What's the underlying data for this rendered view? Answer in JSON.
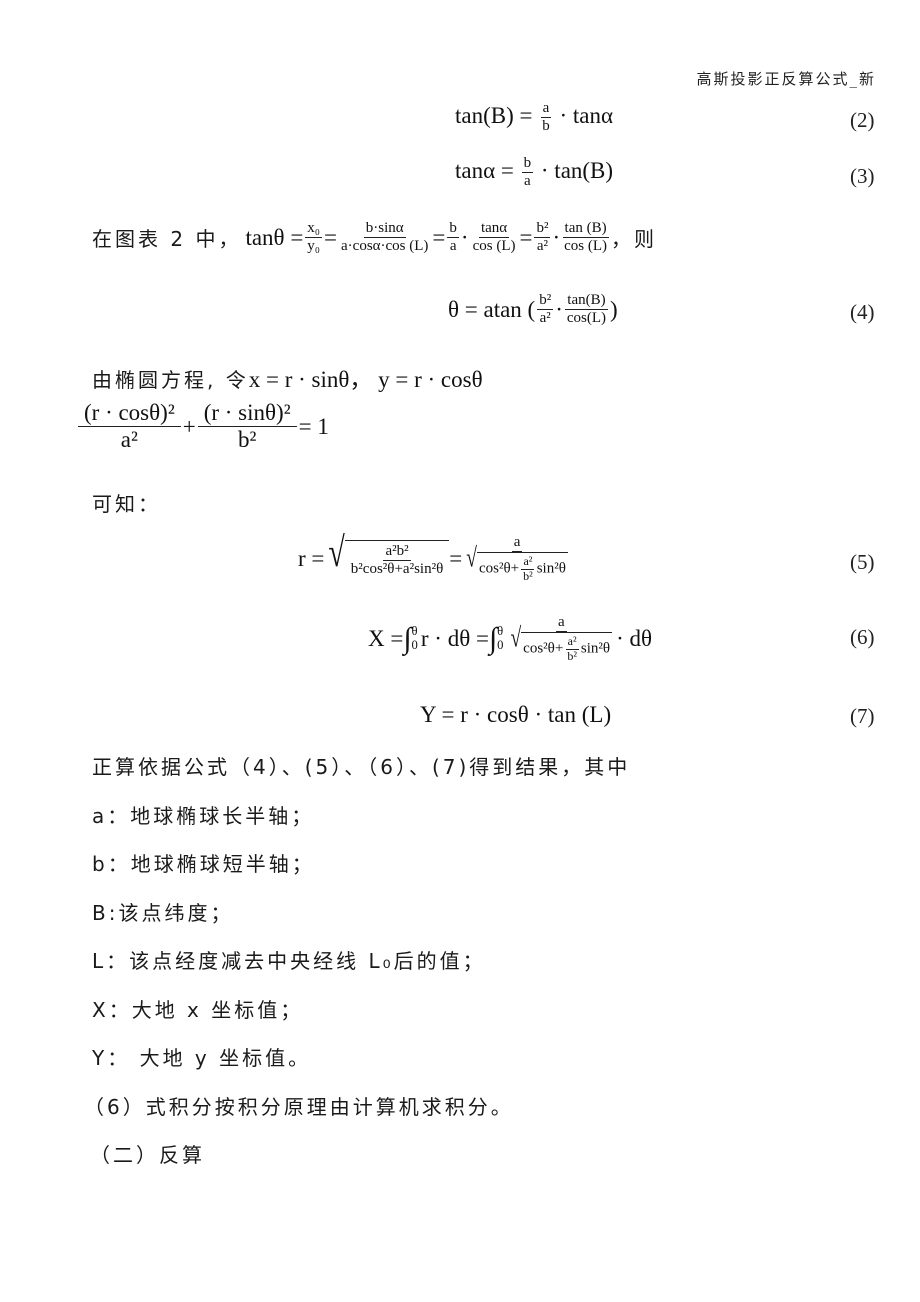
{
  "header": {
    "title": "高斯投影正反算公式_新"
  },
  "equations": {
    "eq2": {
      "lhs": "tan(B)",
      "eq": "=",
      "num": "a",
      "den": "b",
      "rhs": "· tanα",
      "number": "(2)"
    },
    "eq3": {
      "lhs": "tanα",
      "eq": "=",
      "num": "b",
      "den": "a",
      "rhs": "· tan(B)",
      "number": "(3)"
    },
    "intro_line": {
      "prefix": "在图表 2 中，",
      "lhs": "tanθ =",
      "f1_num": "x₀",
      "f1_den": "y₀",
      "f2_num": "b·sinα",
      "f2_den": "a·cosα·cos (L)",
      "f3_num": "b",
      "f3_den": "a",
      "f4_num": "tanα",
      "f4_den": "cos (L)",
      "f5_num": "b²",
      "f5_den": "a²",
      "f6_num": "tan (B)",
      "f6_den": "cos (L)",
      "suffix": "，则"
    },
    "eq4": {
      "lhs": "θ = atan (",
      "f1_num": "b²",
      "f1_den": "a²",
      "dot": "·",
      "f2_num": "tan(B)",
      "f2_den": "cos(L)",
      "close": ")",
      "number": "(4)"
    },
    "ellipse_line": {
      "prefix": "由椭圆方程, 令",
      "formula": "x = r · sinθ，  y = r · cosθ"
    },
    "ellipse_eq": {
      "f1_num": "(r · cosθ)²",
      "f1_den": "a²",
      "plus": "+",
      "f2_num": "(r · sinθ)²",
      "f2_den": "b²",
      "rhs": "= 1"
    },
    "known": "可知：",
    "eq5": {
      "lhs": "r =",
      "in_num": "a²b²",
      "in_den": "b²cos²θ+a²sin²θ",
      "eq": "=",
      "num": "a",
      "den_a": "cos²θ+",
      "den_frac_num": "a²",
      "den_frac_den": "b²",
      "den_b": "sin²θ",
      "number": "(5)"
    },
    "eq6": {
      "lhs": "X =",
      "upper": "θ",
      "lower": "0",
      "mid": "r · dθ =",
      "num": "a",
      "den_a": "cos²θ+",
      "den_frac_num": "a²",
      "den_frac_den": "b²",
      "den_b": "sin²θ",
      "tail": "· dθ",
      "number": "(6)"
    },
    "eq7": {
      "formula": "Y = r · cosθ · tan (L)",
      "number": "(7)"
    }
  },
  "paragraphs": [
    "正算依据公式（4）、(5）、（6）、(7)得到结果，其中",
    "a：地球椭球长半轴；",
    "b：地球椭球短半轴；",
    "B:该点纬度；",
    "L：该点经度减去中央经线 L₀后的值；",
    "X：大地 x 坐标值；",
    "Y：  大地 y 坐标值。",
    "（6）式积分按积分原理由计算机求积分。",
    "（二）反算"
  ]
}
